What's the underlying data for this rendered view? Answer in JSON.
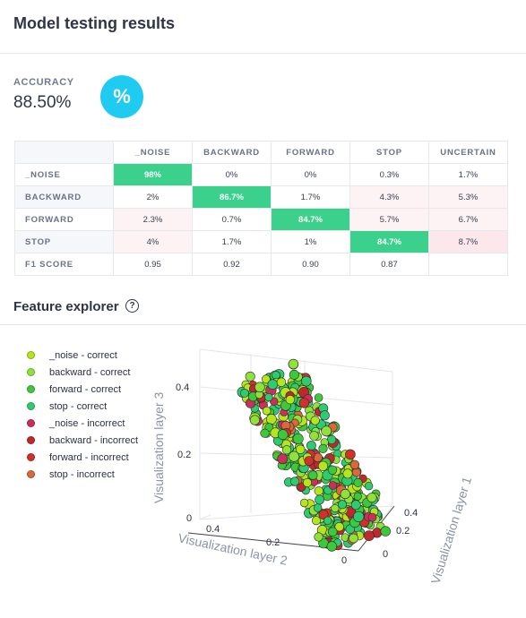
{
  "header": {
    "title": "Model testing results"
  },
  "accuracy": {
    "label": "ACCURACY",
    "value": "88.50%",
    "badge": "%"
  },
  "confusion_matrix": {
    "columns": [
      "_NOISE",
      "BACKWARD",
      "FORWARD",
      "STOP",
      "UNCERTAIN"
    ],
    "rows": [
      {
        "label": "_NOISE",
        "cells": [
          "98%",
          "0%",
          "0%",
          "0.3%",
          "1.7%"
        ]
      },
      {
        "label": "BACKWARD",
        "cells": [
          "2%",
          "86.7%",
          "1.7%",
          "4.3%",
          "5.3%"
        ]
      },
      {
        "label": "FORWARD",
        "cells": [
          "2.3%",
          "0.7%",
          "84.7%",
          "5.7%",
          "6.7%"
        ]
      },
      {
        "label": "STOP",
        "cells": [
          "4%",
          "1.7%",
          "1%",
          "84.7%",
          "8.7%"
        ]
      },
      {
        "label": "F1 SCORE",
        "cells": [
          "0.95",
          "0.92",
          "0.90",
          "0.87",
          ""
        ]
      }
    ]
  },
  "feature_explorer": {
    "title": "Feature explorer",
    "help_icon": "question-circle-icon",
    "legend": [
      {
        "label": "_noise - correct",
        "color": "#b5e61d"
      },
      {
        "label": "backward - correct",
        "color": "#8ee23a"
      },
      {
        "label": "forward - correct",
        "color": "#3cc93c"
      },
      {
        "label": "stop - correct",
        "color": "#2ecc71"
      },
      {
        "label": "_noise - incorrect",
        "color": "#c9305a"
      },
      {
        "label": "backward - incorrect",
        "color": "#c0282d"
      },
      {
        "label": "forward - incorrect",
        "color": "#d2302a"
      },
      {
        "label": "stop - incorrect",
        "color": "#d9683a"
      }
    ],
    "axes": {
      "x_title": "Visualization layer 2",
      "y_title": "Visualization layer 1",
      "z_title": "Visualization layer 3",
      "x_ticks": [
        "0.4",
        "0.2",
        "0"
      ],
      "y_ticks": [
        "0.4",
        "0.2",
        "0"
      ],
      "z_ticks": [
        "0.4",
        "0.2",
        "0"
      ]
    }
  },
  "chart_data": {
    "type": "scatter",
    "title": "",
    "xlabel": "Visualization layer 2",
    "ylabel": "Visualization layer 1",
    "zlabel": "Visualization layer 3",
    "series": [
      {
        "name": "_noise - correct"
      },
      {
        "name": "backward - correct"
      },
      {
        "name": "forward - correct"
      },
      {
        "name": "stop - correct"
      },
      {
        "name": "_noise - incorrect"
      },
      {
        "name": "backward - incorrect"
      },
      {
        "name": "forward - incorrect"
      },
      {
        "name": "stop - incorrect"
      }
    ]
  }
}
